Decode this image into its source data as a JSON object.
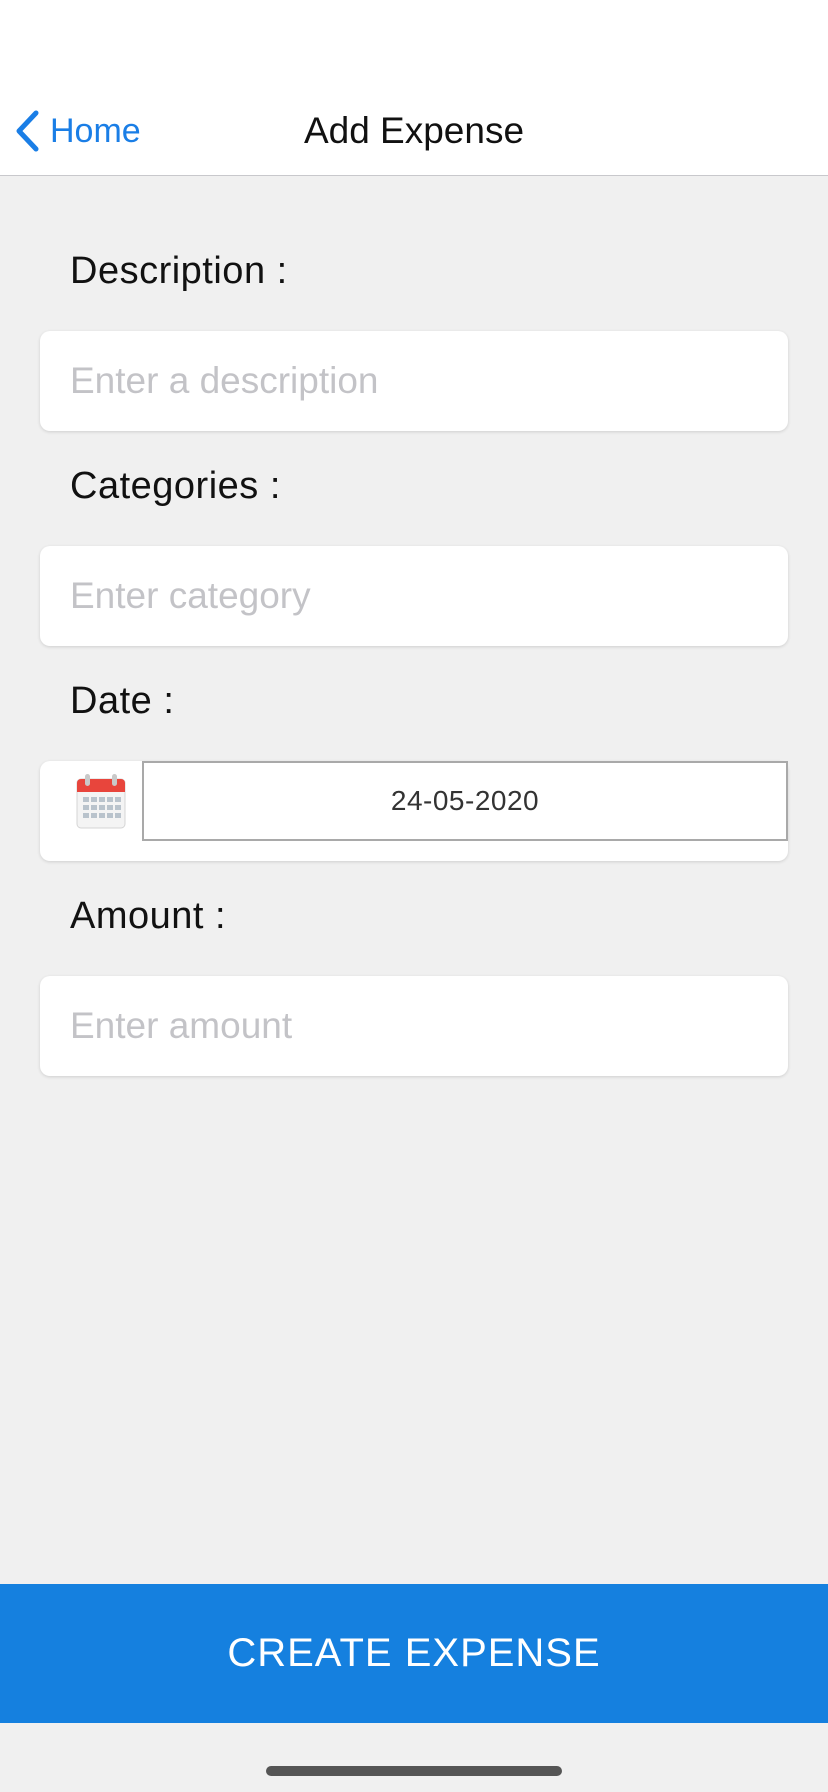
{
  "nav": {
    "back_label": "Home",
    "title": "Add Expense"
  },
  "form": {
    "description": {
      "label": "Description :",
      "placeholder": "Enter a description",
      "value": ""
    },
    "category": {
      "label": "Categories :",
      "placeholder": "Enter category",
      "value": ""
    },
    "date": {
      "label": "Date :",
      "value": "24-05-2020",
      "icon": "calendar-icon"
    },
    "amount": {
      "label": "Amount :",
      "placeholder": "Enter amount",
      "value": ""
    }
  },
  "actions": {
    "create_label": "CREATE EXPENSE"
  },
  "colors": {
    "accent": "#1a7ee6",
    "button": "#1580df",
    "background": "#f0f0f0",
    "calendar_red": "#e8453c"
  }
}
